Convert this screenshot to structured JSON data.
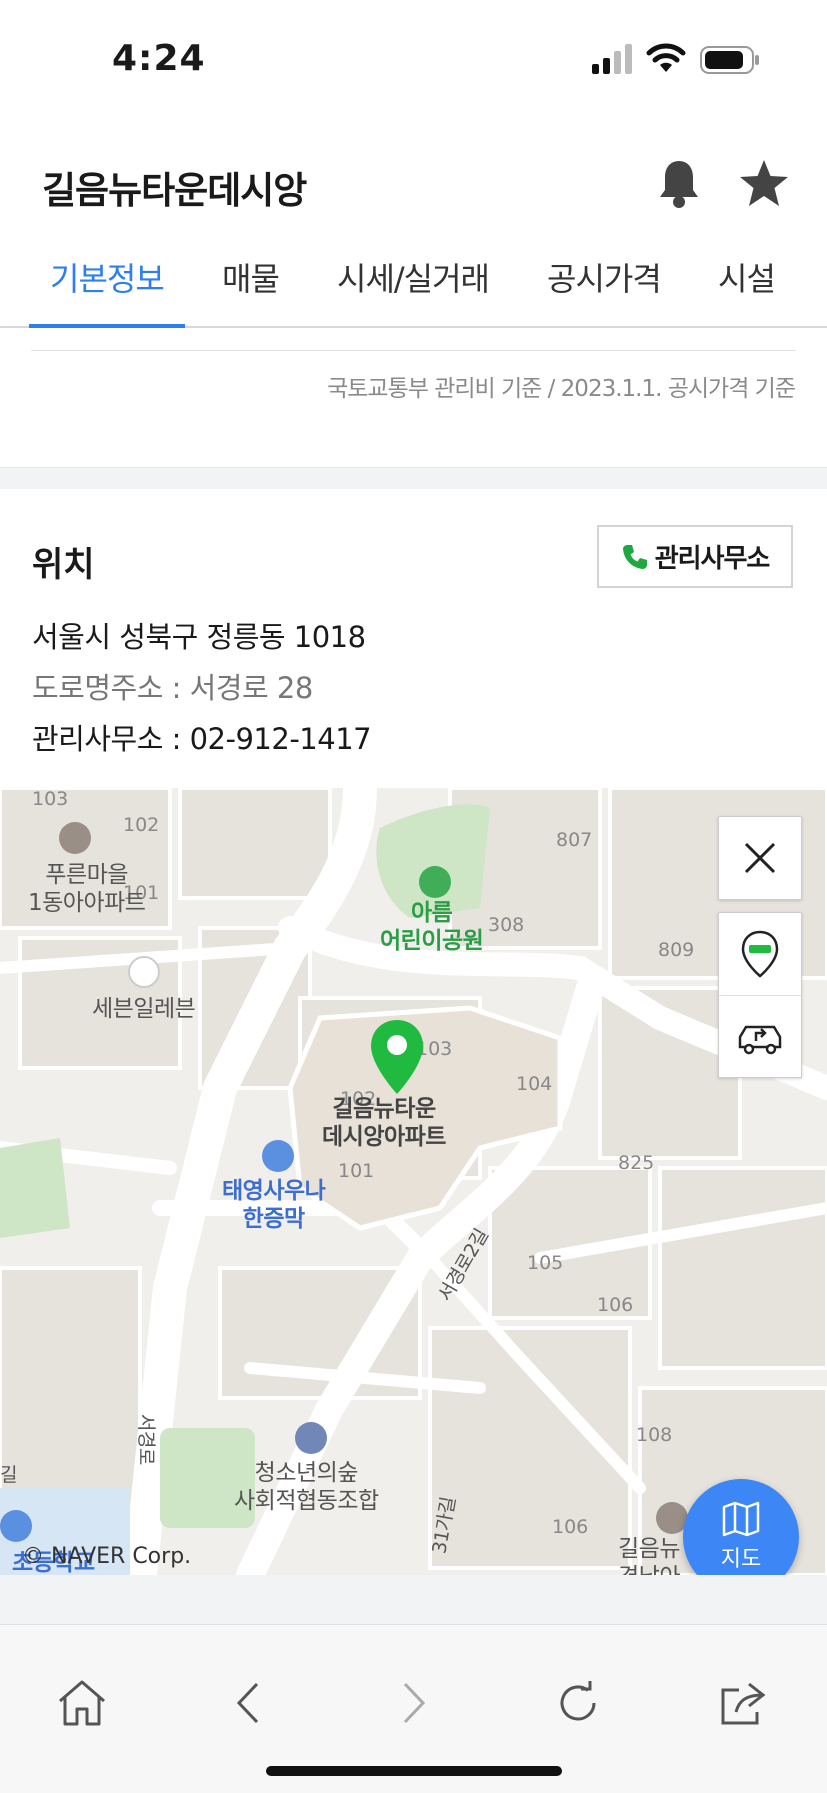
{
  "status_bar": {
    "time": "4:24"
  },
  "header": {
    "title": "길음뉴타운데시앙"
  },
  "tabs": [
    {
      "label": "기본정보",
      "active": true
    },
    {
      "label": "매물",
      "active": false
    },
    {
      "label": "시세/실거래",
      "active": false
    },
    {
      "label": "공시가격",
      "active": false
    },
    {
      "label": "시설",
      "active": false
    }
  ],
  "notice": "국토교통부 관리비 기준 / 2023.1.1. 공시가격 기준",
  "location": {
    "title": "위치",
    "office_button": "관리사무소",
    "address": "서울시 성북구 정릉동 1018",
    "road_address": "도로명주소 : 서경로 28",
    "office_phone": "관리사무소 : 02-912-1417"
  },
  "map": {
    "labels": {
      "purun": "푸른마을\n1동아아파트",
      "park": "아름\n어린이공원",
      "seven": "세븐일레븐",
      "apt": "길음뉴타운\n데시앙아파트",
      "sauna": "태영사우나\n한증막",
      "coop": "청소년의숲\n사회적협동조합",
      "road1": "서경로2길",
      "road2": "서경로",
      "road3": "31가길",
      "bottom_right": "길음뉴\n경남아",
      "school": "초등학교",
      "gil": "길"
    },
    "numbers": [
      "103",
      "102",
      "101",
      "807",
      "308",
      "809",
      "103",
      "104",
      "102",
      "101",
      "825",
      "105",
      "106",
      "108",
      "106"
    ],
    "copyright": "© NAVER Corp.",
    "fab_label": "지도"
  },
  "colors": {
    "accent": "#2d7ff0",
    "marker": "#1fba3f",
    "fab": "#3d86f5"
  }
}
